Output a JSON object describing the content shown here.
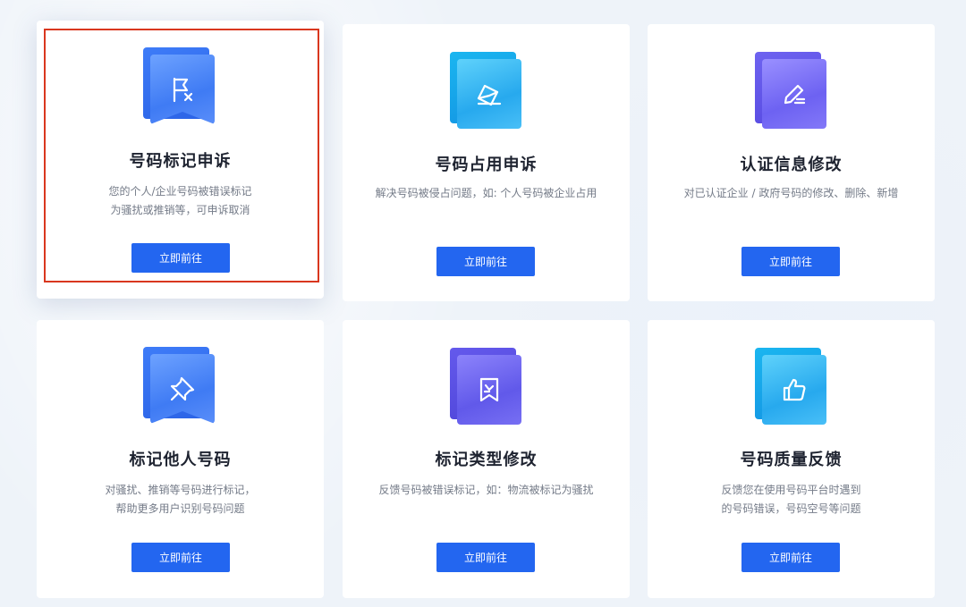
{
  "cards": [
    {
      "title": "号码标记申诉",
      "desc_line1": "您的个人/企业号码被错误标记",
      "desc_line2": "为骚扰或推销等，可申诉取消",
      "button": "立即前往",
      "icon": "flag-x-icon",
      "selected": true
    },
    {
      "title": "号码占用申诉",
      "desc_line1": "解决号码被侵占问题，如: 个人号码被企业占用",
      "button": "立即前往",
      "icon": "envelope-icon"
    },
    {
      "title": "认证信息修改",
      "desc_line1": "对已认证企业 / 政府号码的修改、删除、新增",
      "button": "立即前往",
      "icon": "edit-pen-icon"
    },
    {
      "title": "标记他人号码",
      "desc_line1": "对骚扰、推销等号码进行标记，",
      "desc_line2": "帮助更多用户识别号码问题",
      "button": "立即前往",
      "icon": "pin-icon"
    },
    {
      "title": "标记类型修改",
      "desc_line1": "反馈号码被错误标记，如：物流被标记为骚扰",
      "button": "立即前往",
      "icon": "bookmark-edit-icon"
    },
    {
      "title": "号码质量反馈",
      "desc_line1": "反馈您在使用号码平台时遇到",
      "desc_line2": "的号码错误，号码空号等问题",
      "button": "立即前往",
      "icon": "thumbs-up-icon"
    }
  ],
  "colors": {
    "button": "#2366f0",
    "highlight": "#d9371f",
    "title": "#1e2330",
    "desc": "#747b88"
  }
}
